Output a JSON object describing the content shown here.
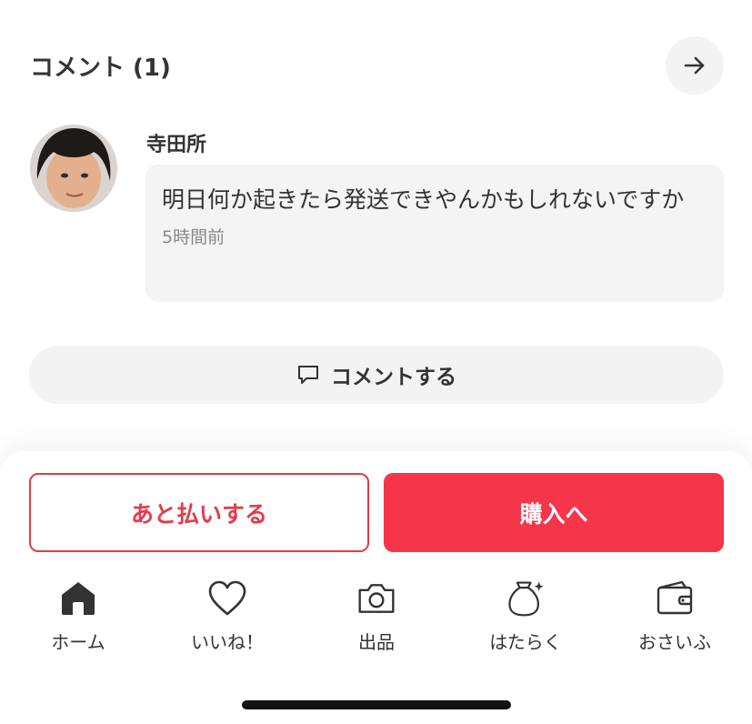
{
  "comments_section": {
    "title": "コメント (1)",
    "comments": [
      {
        "author": "寺田所",
        "text": "明日何か起きたら発送できやんかもしれないですか",
        "time": "5時間前"
      }
    ],
    "comment_button_label": "コメントする"
  },
  "actions": {
    "pay_later_label": "あと払いする",
    "purchase_label": "購入へ",
    "accent_color": "#f5364a"
  },
  "tab_bar": {
    "items": [
      {
        "label": "ホーム",
        "icon": "home-icon"
      },
      {
        "label": "いいね！",
        "icon": "heart-icon"
      },
      {
        "label": "出品",
        "icon": "camera-icon"
      },
      {
        "label": "はたらく",
        "icon": "money-bag-icon"
      },
      {
        "label": "おさいふ",
        "icon": "wallet-icon"
      }
    ]
  }
}
